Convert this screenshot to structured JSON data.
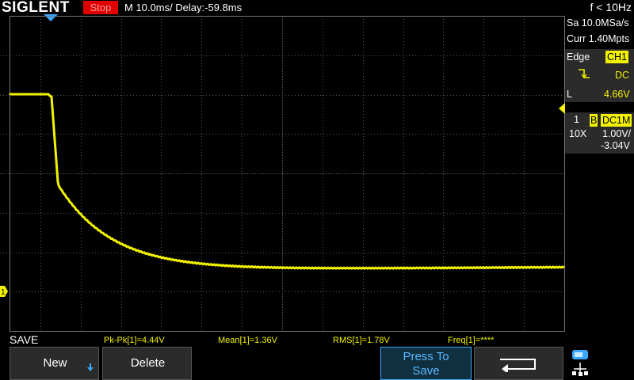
{
  "header": {
    "brand": "SIGLENT",
    "run_status": "Stop",
    "timebase": "M 10.0ms/ Delay:-59.8ms",
    "freq_counter": "f < 10Hz"
  },
  "acquisition": {
    "sample_rate": "Sa 10.0MSa/s",
    "memory_depth": "Curr 1.40Mpts"
  },
  "trigger": {
    "type": "Edge",
    "source": "CH1",
    "slope_icon": "rising-edge-icon",
    "coupling": "DC",
    "level_label": "L",
    "level_value": "4.66V"
  },
  "channel": {
    "number": "1",
    "bandwidth_tag": "B",
    "coupling_tag": "DC1M",
    "probe": "10X",
    "scale": "1.00V/",
    "offset": "-3.04V"
  },
  "waveform": {
    "color": "#f2f200",
    "ground_marker_label": "1"
  },
  "footer": {
    "menu_title": "SAVE",
    "measurements": [
      {
        "label": "Pk-Pk[1]=4.44V"
      },
      {
        "label": "Mean[1]=1.36V"
      },
      {
        "label": "RMS[1]=1.78V"
      },
      {
        "label": "Freq[1]=****"
      }
    ],
    "softkeys": {
      "new_label": "New",
      "delete_label": "Delete",
      "press_to_line1": "Press To",
      "press_to_line2": "Save",
      "back_icon": "return-arrow-icon",
      "usb_icon": "usb-storage-icon"
    }
  },
  "colors": {
    "trace": "#f2f200",
    "stop": "#e00000",
    "grid": "#5a5a5a",
    "marker_blue": "#3aa8ff"
  }
}
